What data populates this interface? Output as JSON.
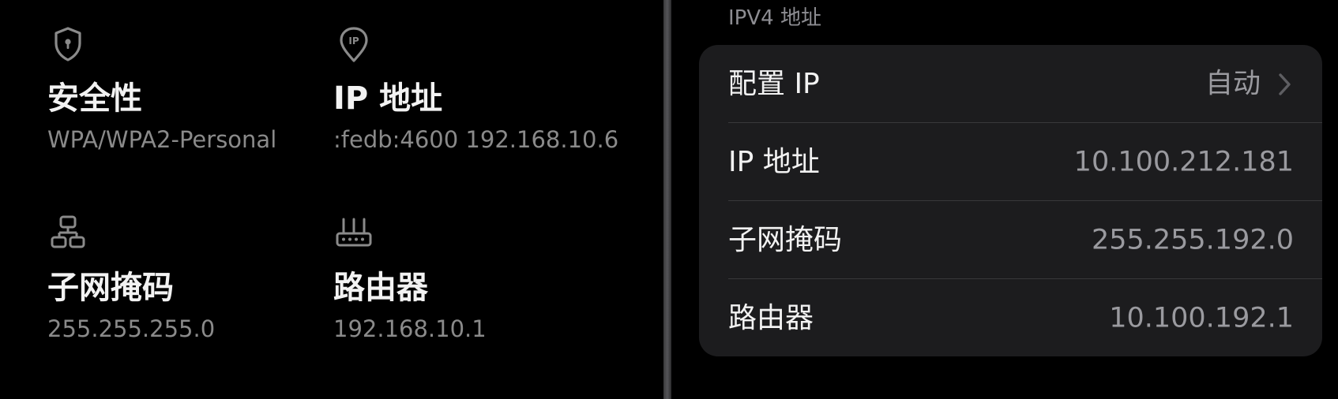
{
  "left_panel": {
    "items": [
      {
        "icon": "shield-icon",
        "title": "安全性",
        "value": "WPA/WPA2-Personal"
      },
      {
        "icon": "ip-location-icon",
        "title": "IP 地址",
        "value": ":fedb:4600 192.168.10.6"
      },
      {
        "icon": "network-topology-icon",
        "title": "子网掩码",
        "value": "255.255.255.0"
      },
      {
        "icon": "router-icon",
        "title": "路由器",
        "value": "192.168.10.1"
      }
    ]
  },
  "right_panel": {
    "section_header": "IPV4 地址",
    "rows": [
      {
        "label": "配置 IP",
        "value": "自动",
        "chevron": "chevron-right-icon"
      },
      {
        "label": "IP 地址",
        "value": "10.100.212.181"
      },
      {
        "label": "子网掩码",
        "value": "255.255.192.0"
      },
      {
        "label": "路由器",
        "value": "10.100.192.1"
      }
    ]
  },
  "colors": {
    "background": "#000000",
    "card": "#1c1c1e",
    "primary_text": "#f2f2f2",
    "secondary_text": "#8a8a8a",
    "separator": "#38383a"
  }
}
